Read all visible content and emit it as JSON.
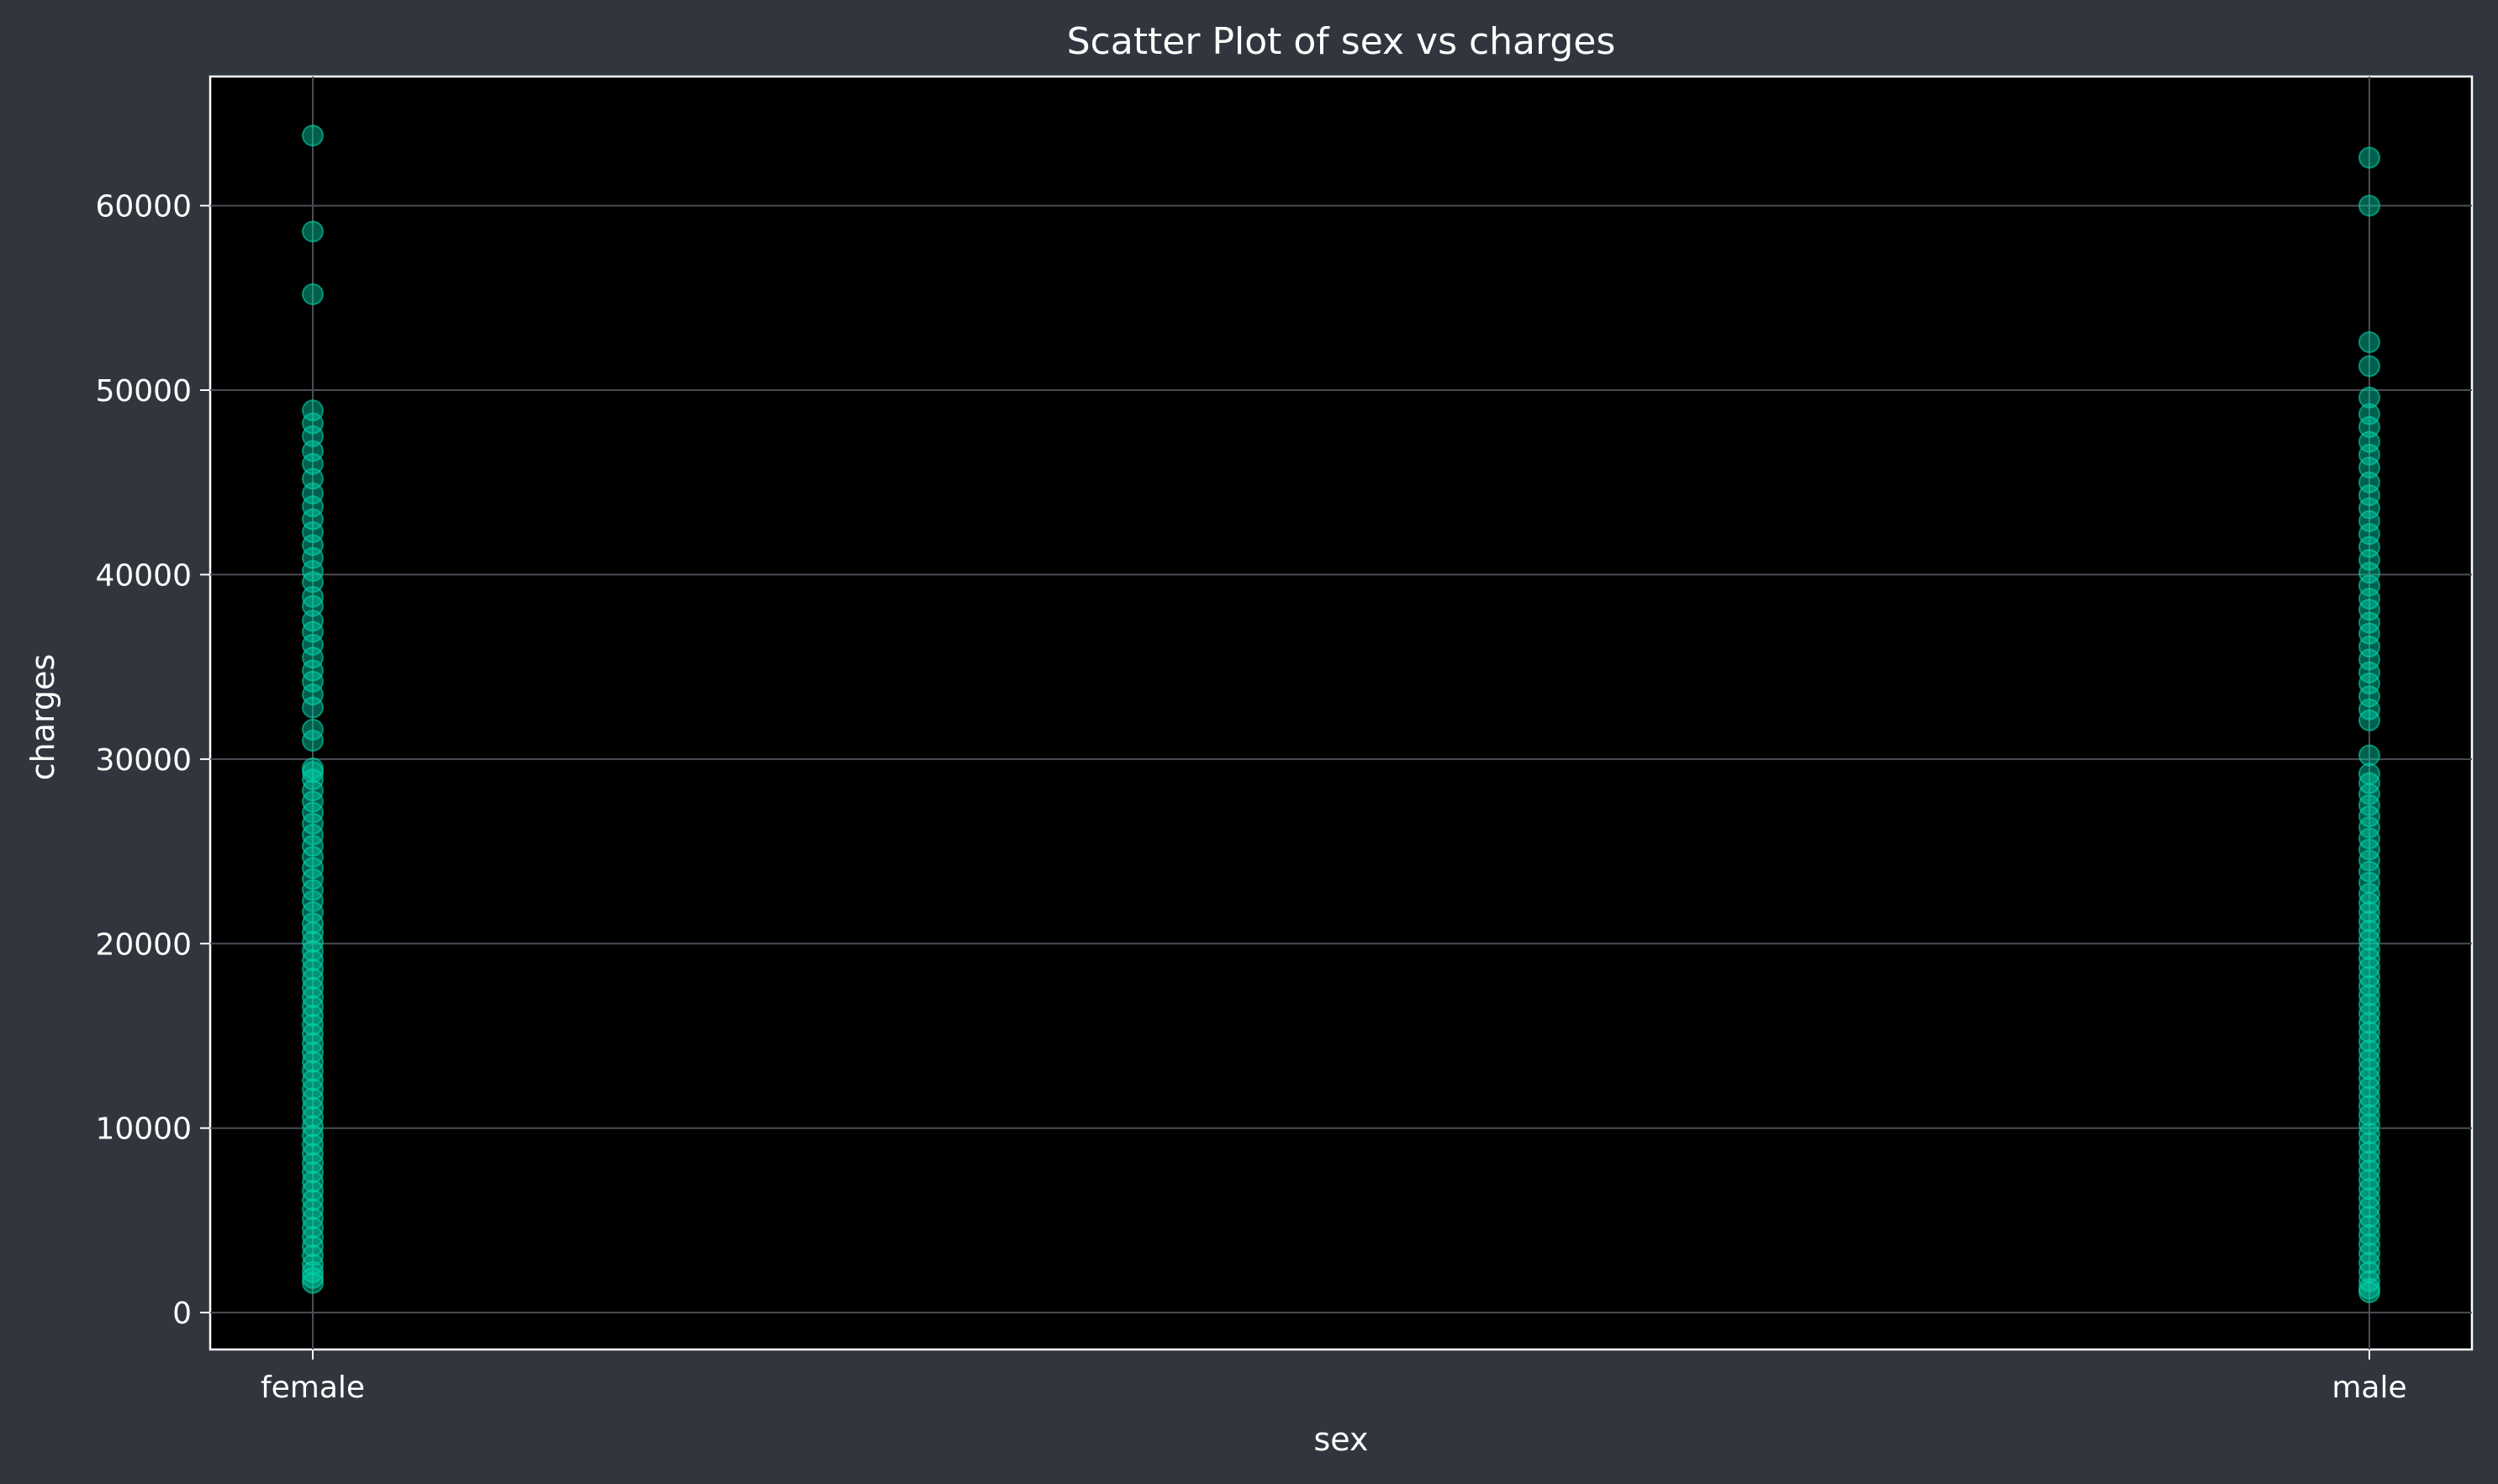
{
  "chart_data": {
    "type": "scatter",
    "title": "Scatter Plot of sex vs charges",
    "xlabel": "sex",
    "ylabel": "charges",
    "categories": [
      "female",
      "male"
    ],
    "ylim": [
      -2000,
      67000
    ],
    "yticks": [
      0,
      10000,
      20000,
      30000,
      40000,
      50000,
      60000
    ],
    "grid": true,
    "color": "#00d4aa",
    "series": [
      {
        "category": "female",
        "values": [
          1607,
          1880,
          2200,
          2600,
          3100,
          3600,
          4100,
          4600,
          5100,
          5600,
          6100,
          6600,
          7100,
          7600,
          8100,
          8600,
          9100,
          9600,
          10100,
          10600,
          11100,
          11600,
          12100,
          12600,
          13100,
          13600,
          14100,
          14600,
          15100,
          15600,
          16100,
          16600,
          17100,
          17600,
          18100,
          18600,
          19100,
          19600,
          20100,
          20600,
          21100,
          21700,
          22300,
          22900,
          23500,
          24100,
          24700,
          25300,
          25900,
          26500,
          27100,
          27700,
          28300,
          28900,
          29300,
          29500,
          31000,
          31600,
          32800,
          33500,
          34200,
          34800,
          35500,
          36200,
          36900,
          37500,
          38300,
          38800,
          39600,
          40200,
          40900,
          41600,
          42300,
          43000,
          43700,
          44400,
          45200,
          46000,
          46700,
          47500,
          48200,
          48900,
          55200,
          58600,
          63800
        ]
      },
      {
        "category": "male",
        "values": [
          1100,
          1300,
          1700,
          2200,
          2700,
          3200,
          3700,
          4200,
          4700,
          5200,
          5700,
          6200,
          6700,
          7200,
          7700,
          8200,
          8700,
          9200,
          9700,
          10200,
          10700,
          11200,
          11700,
          12200,
          12700,
          13200,
          13700,
          14200,
          14700,
          15200,
          15700,
          16200,
          16700,
          17200,
          17700,
          18200,
          18700,
          19200,
          19700,
          20200,
          20700,
          21200,
          21700,
          22200,
          22700,
          23300,
          23900,
          24500,
          25100,
          25700,
          26300,
          26900,
          27500,
          28100,
          28700,
          29200,
          30200,
          32100,
          32700,
          33400,
          34100,
          34700,
          35400,
          36100,
          36800,
          37400,
          38100,
          38700,
          39400,
          40100,
          40800,
          41500,
          42200,
          42900,
          43600,
          44300,
          45000,
          45800,
          46500,
          47200,
          48000,
          48700,
          49600,
          51300,
          52600,
          60000,
          62600
        ]
      }
    ]
  }
}
